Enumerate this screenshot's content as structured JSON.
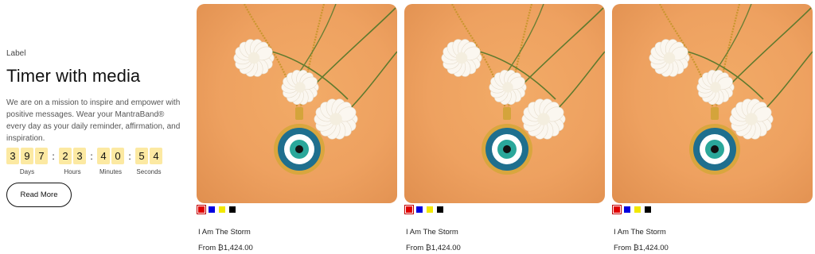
{
  "section": {
    "eyebrow": "Label",
    "title": "Timer with media",
    "description": "We are on a mission to inspire and empower with positive messages. Wear your MantraBand® every day as your daily reminder, affirmation, and inspiration.",
    "cta_label": "Read More"
  },
  "timer": {
    "units": [
      {
        "digits": [
          "3",
          "9",
          "7"
        ],
        "label": "Days"
      },
      {
        "digits": [
          "2",
          "3"
        ],
        "label": "Hours"
      },
      {
        "digits": [
          "4",
          "0"
        ],
        "label": "Minutes"
      },
      {
        "digits": [
          "5",
          "4"
        ],
        "label": "Seconds"
      }
    ],
    "separator": ":"
  },
  "products": [
    {
      "name": "I Am The Storm",
      "price": "From ₿1,424.00",
      "image": "evil-eye-pendant-necklace-with-flowers",
      "swatches": [
        {
          "color": "#e00000",
          "selected": true
        },
        {
          "color": "#0000e0",
          "selected": false
        },
        {
          "color": "#f2e800",
          "selected": false
        },
        {
          "color": "#000000",
          "selected": false
        }
      ]
    },
    {
      "name": "I Am The Storm",
      "price": "From ₿1,424.00",
      "image": "evil-eye-pendant-necklace-with-flowers",
      "swatches": [
        {
          "color": "#e00000",
          "selected": true
        },
        {
          "color": "#0000e0",
          "selected": false
        },
        {
          "color": "#f2e800",
          "selected": false
        },
        {
          "color": "#000000",
          "selected": false
        }
      ]
    },
    {
      "name": "I Am The Storm",
      "price": "From ₿1,424.00",
      "image": "evil-eye-pendant-necklace-with-flowers",
      "swatches": [
        {
          "color": "#e00000",
          "selected": true
        },
        {
          "color": "#0000e0",
          "selected": false
        },
        {
          "color": "#f2e800",
          "selected": false
        },
        {
          "color": "#000000",
          "selected": false
        }
      ]
    }
  ]
}
